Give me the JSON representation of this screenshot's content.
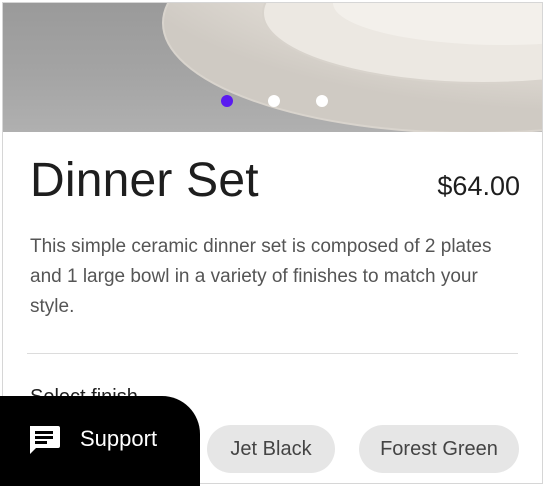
{
  "product": {
    "title": "Dinner Set",
    "price": "$64.00",
    "description": "This simple ceramic dinner set is composed of 2 plates and 1 large bowl in a variety of finishes to match your style."
  },
  "carousel": {
    "slide_count": 3,
    "active_index": 0,
    "active_color": "#5a1af0",
    "inactive_color": "#ffffff"
  },
  "finish": {
    "label": "Select finish",
    "options": [
      "Jet Black",
      "Forest Green"
    ]
  },
  "support": {
    "label": "Support",
    "icon": "chat-bubble-icon"
  }
}
